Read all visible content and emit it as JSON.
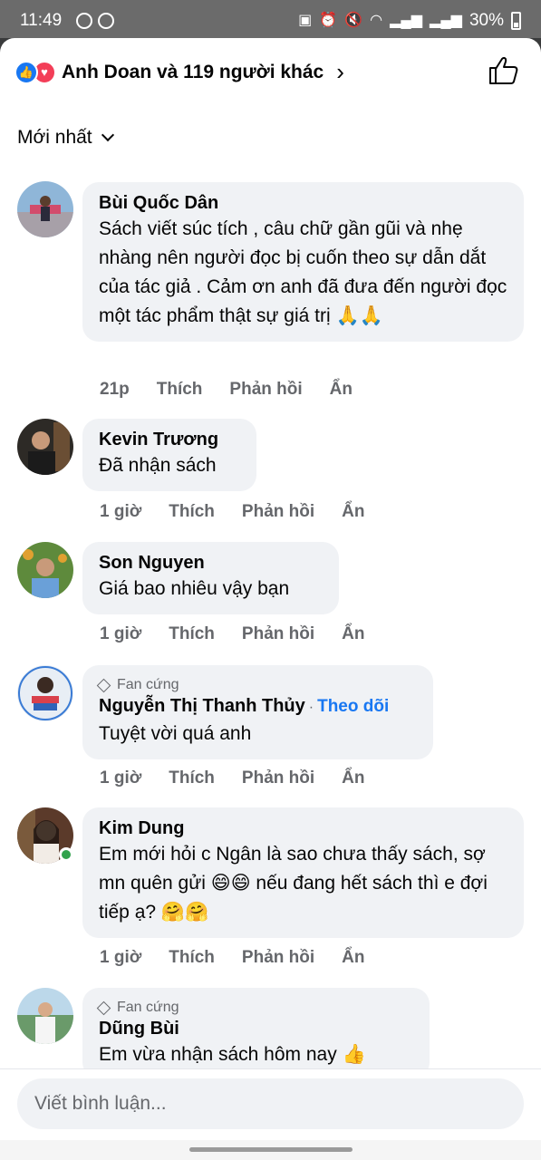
{
  "status_bar": {
    "time": "11:49",
    "battery": "30%",
    "icons": [
      "shazam-icon",
      "messenger-icon",
      "screenshot-icon",
      "alarm-icon",
      "mute-icon",
      "wifi-icon",
      "signal-icon",
      "signal-icon-2",
      "battery-icon"
    ]
  },
  "header": {
    "reactions_text": "Anh Doan và 119 người khác",
    "like_icon": "like-reaction-icon",
    "love_icon": "love-reaction-icon"
  },
  "sort": {
    "label": "Mới nhất"
  },
  "comments": [
    {
      "author": "Bùi Quốc Dân",
      "body": "Sách viết súc tích , câu chữ gần gũi và nhẹ nhàng nên người đọc bị cuốn theo sự dẫn dắt của tác giả . Cảm ơn anh đã đưa đến người đọc một tác phẩm thật sự giá trị 🙏🙏",
      "time": "21p",
      "like": "Thích",
      "reply": "Phản hồi",
      "hide": "Ẩn"
    },
    {
      "author": "Kevin Trương",
      "body": "Đã nhận sách",
      "time": "1 giờ",
      "like": "Thích",
      "reply": "Phản hồi",
      "hide": "Ẩn"
    },
    {
      "author": "Son Nguyen",
      "body": "Giá bao nhiêu vậy bạn",
      "time": "1 giờ",
      "like": "Thích",
      "reply": "Phản hồi",
      "hide": "Ẩn"
    },
    {
      "badge": "Fan cứng",
      "author": "Nguyễn Thị Thanh Thủy",
      "follow": "Theo dõi",
      "body": "Tuyệt vời quá anh",
      "time": "1 giờ",
      "like": "Thích",
      "reply": "Phản hồi",
      "hide": "Ẩn"
    },
    {
      "author": "Kim Dung",
      "body": "Em mới hỏi c Ngân là sao chưa thấy sách, sợ mn quên gửi 😄😄 nếu đang hết sách thì e đợi tiếp ạ? 🤗🤗",
      "time": "1 giờ",
      "like": "Thích",
      "reply": "Phản hồi",
      "hide": "Ẩn",
      "online": true
    },
    {
      "badge": "Fan cứng",
      "author": "Dũng Bùi",
      "body": "Em vừa nhận sách hôm nay 👍"
    }
  ],
  "composer": {
    "placeholder": "Viết bình luận..."
  },
  "colors": {
    "accent": "#1877f2",
    "bubble": "#f0f2f5",
    "secondary_text": "#65676b",
    "online": "#31a24c"
  }
}
